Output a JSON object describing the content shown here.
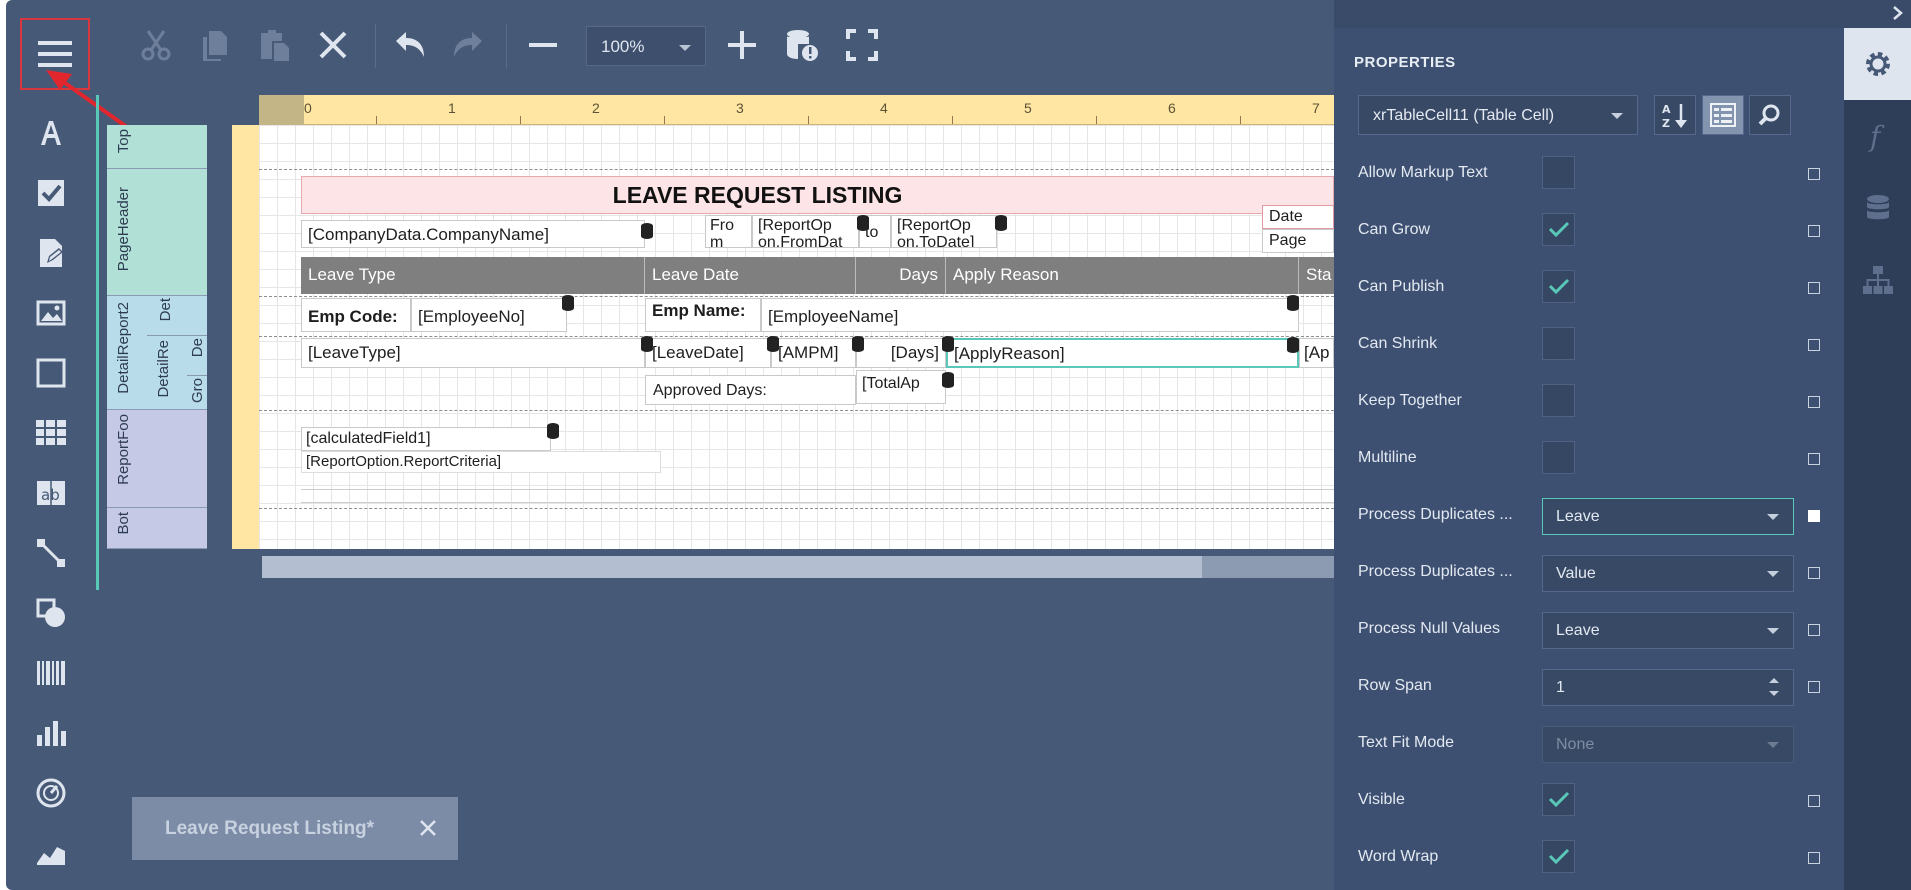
{
  "toolbar": {
    "zoom": "100%"
  },
  "report": {
    "title": "LEAVE REQUEST LISTING",
    "company_name": "[CompanyData.CompanyName]",
    "from_label": "Fro m",
    "report_from": "[ReportOp on.FromDat",
    "to_label": "to",
    "report_to": "[ReportOp on.ToDate]",
    "date_label": "Date",
    "page_label": "Page",
    "headers": [
      "Leave Type",
      "Leave Date",
      "Days",
      "Apply Reason",
      "Sta"
    ],
    "emp_code_label": "Emp Code:",
    "employee_no": "[EmployeeNo]",
    "emp_name_label": "Emp Name:",
    "employee_name": "[EmployeeName]",
    "leave_type": "[LeaveType]",
    "leave_date": "[LeaveDate]",
    "ampm": "[AMPM]",
    "days": "[Days]",
    "apply_reason": "[ApplyReason]",
    "apply_overflow": "[Ap",
    "approved_days_label": "Approved Days:",
    "total_approved": "[TotalAp",
    "calculated_field": "[calculatedField1]",
    "report_criteria": "[ReportOption.ReportCriteria]"
  },
  "bands": {
    "top": "Top",
    "page_header": "PageHeader",
    "detail_report": "DetailReport2",
    "detail_1": "Det",
    "detail_report_inner": "DetailRe",
    "detail_2": "De",
    "detail_3": "De",
    "group": "Gro",
    "report_footer": "ReportFoo",
    "bottom": "Bot"
  },
  "ruler": [
    "0",
    "1",
    "2",
    "3",
    "4",
    "5",
    "6",
    "7"
  ],
  "document_tab": {
    "label": "Leave Request Listing*"
  },
  "properties": {
    "title": "PROPERTIES",
    "selected_object": "xrTableCell11 (Table Cell)",
    "rows": [
      {
        "label": "Allow Markup Text",
        "type": "check",
        "checked": false
      },
      {
        "label": "Can Grow",
        "type": "check",
        "checked": true
      },
      {
        "label": "Can Publish",
        "type": "check",
        "checked": true
      },
      {
        "label": "Can Shrink",
        "type": "check",
        "checked": false
      },
      {
        "label": "Keep Together",
        "type": "check",
        "checked": false
      },
      {
        "label": "Multiline",
        "type": "check",
        "checked": false
      },
      {
        "label": "Process Duplicates ...",
        "type": "select",
        "value": "Leave"
      },
      {
        "label": "Process Duplicates ...",
        "type": "select",
        "value": "Value"
      },
      {
        "label": "Process Null Values",
        "type": "select",
        "value": "Leave"
      },
      {
        "label": "Row Span",
        "type": "spin",
        "value": "1"
      },
      {
        "label": "Text Fit Mode",
        "type": "select",
        "value": "None"
      },
      {
        "label": "Visible",
        "type": "check",
        "checked": true
      },
      {
        "label": "Word Wrap",
        "type": "check",
        "checked": true
      }
    ]
  },
  "colors": {
    "app_bg": "#465a78",
    "panel_bg": "#3e5071",
    "accent": "#5ac8b8",
    "highlight_border": "#d9363e",
    "title_band": "#fde4e6",
    "header_cell": "#7f7f7f"
  }
}
